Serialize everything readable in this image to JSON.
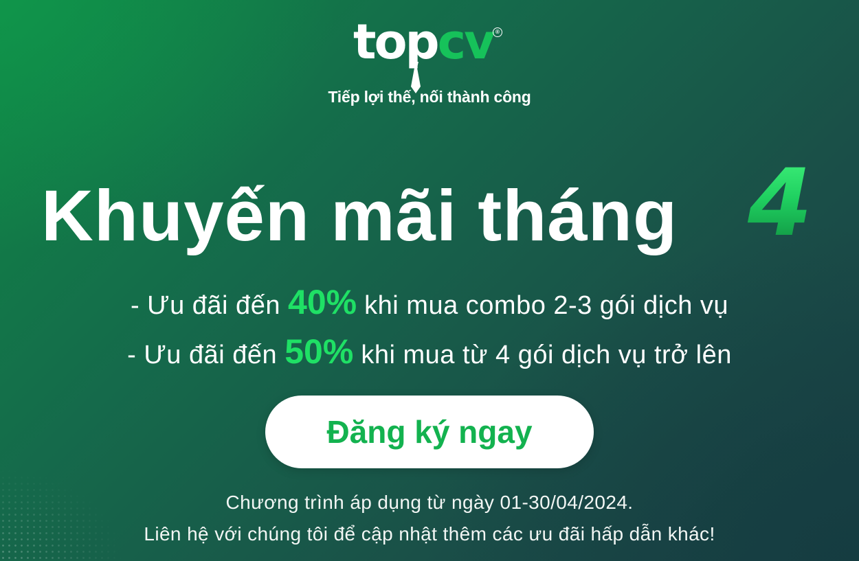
{
  "logo": {
    "part_white": "top",
    "part_green": "cv",
    "registered_mark": "®"
  },
  "tagline": "Tiếp lợi thế, nối thành công",
  "headline": {
    "text": "Khuyến mãi tháng",
    "number": "4"
  },
  "offers": [
    {
      "prefix": "- Ưu đãi đến",
      "percent": "40%",
      "suffix": "khi mua combo 2-3 gói dịch vụ"
    },
    {
      "prefix": "- Ưu đãi đến",
      "percent": "50%",
      "suffix": "khi mua từ 4 gói dịch vụ trở lên"
    }
  ],
  "cta": {
    "label": "Đăng ký ngay"
  },
  "notes": {
    "period": "Chương trình áp dụng từ ngày 01-30/04/2024.",
    "contact": "Liên hệ với chúng tôi để cập nhật thêm các ưu đãi hấp dẫn khác!"
  },
  "colors": {
    "brand_green": "#16c25a",
    "highlight_green": "#1fe065",
    "cta_text": "#13b24f",
    "background_dark": "#1b3f45"
  },
  "icons": [
    "tie-icon",
    "registered-icon"
  ]
}
